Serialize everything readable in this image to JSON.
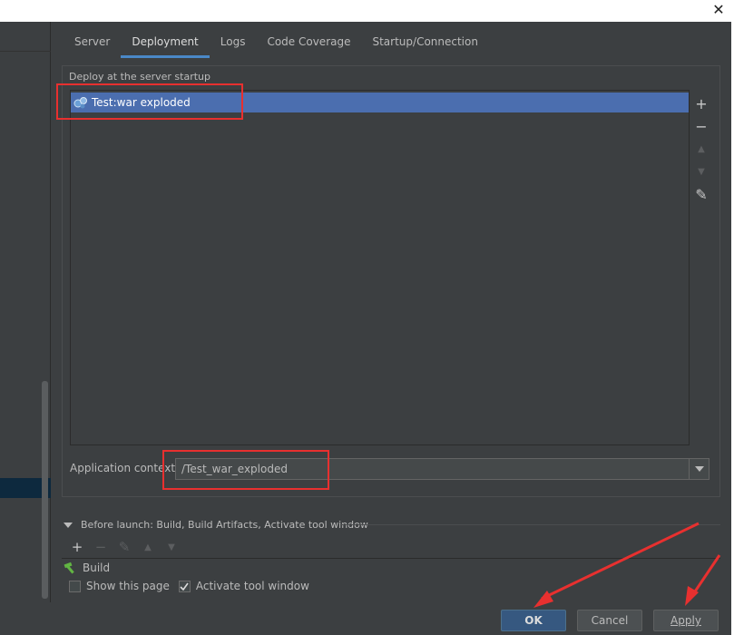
{
  "window": {
    "close_glyph": "✕"
  },
  "tabs": [
    {
      "label": "Server"
    },
    {
      "label": "Deployment"
    },
    {
      "label": "Logs"
    },
    {
      "label": "Code Coverage"
    },
    {
      "label": "Startup/Connection"
    }
  ],
  "active_tab": "Deployment",
  "deploy": {
    "group_title": "Deploy at the server startup",
    "items": [
      {
        "label": "Test:war exploded",
        "icon": "artifact-icon",
        "selected": true
      }
    ],
    "side_tools": [
      {
        "icon": "plus-icon",
        "glyph": "+",
        "enabled": true
      },
      {
        "icon": "minus-icon",
        "glyph": "−",
        "enabled": true
      },
      {
        "icon": "arrow-up-icon",
        "glyph": "▲",
        "enabled": false
      },
      {
        "icon": "arrow-down-icon",
        "glyph": "▼",
        "enabled": false
      },
      {
        "icon": "pencil-icon",
        "glyph": "✎",
        "enabled": true
      }
    ]
  },
  "app_context": {
    "label": "Application context:",
    "value": "/Test_war_exploded"
  },
  "before_launch": {
    "header": "Before launch: Build, Build Artifacts, Activate tool window",
    "tools": [
      {
        "icon": "plus-icon",
        "glyph": "+",
        "enabled": true
      },
      {
        "icon": "minus-icon",
        "glyph": "−",
        "enabled": false
      },
      {
        "icon": "pencil-icon",
        "glyph": "✎",
        "enabled": false
      },
      {
        "icon": "arrow-up-icon",
        "glyph": "▲",
        "enabled": false
      },
      {
        "icon": "arrow-down-icon",
        "glyph": "▼",
        "enabled": false
      }
    ],
    "items": [
      {
        "label": "Build",
        "icon": "hammer-icon"
      }
    ]
  },
  "checkboxes": [
    {
      "label": "Show this page",
      "checked": false
    },
    {
      "label": "Activate tool window",
      "checked": true
    }
  ],
  "buttons": {
    "ok": "OK",
    "cancel": "Cancel",
    "apply": "Apply"
  },
  "colors": {
    "background": "#3c3f41",
    "selection": "#4b6eaf",
    "accent": "#4a88c7",
    "annotation": "#e8302f"
  }
}
